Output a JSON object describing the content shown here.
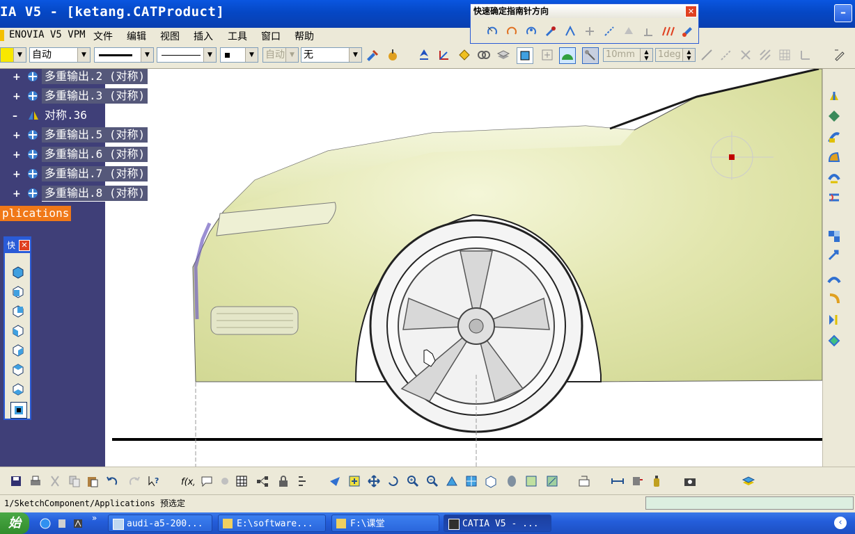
{
  "window": {
    "title": "IA V5 - [ketang.CATProduct]"
  },
  "menu": {
    "items": [
      "ENOVIA V5 VPM",
      "文件",
      "编辑",
      "视图",
      "插入",
      "工具",
      "窗口",
      "帮助"
    ]
  },
  "property_toolbar": {
    "color_combo": "自动",
    "layer_combo": "自动",
    "layer_fill_combo": "无",
    "length_field": "10mm",
    "angle_field": "1deg"
  },
  "compass_dialog": {
    "title": "快速确定指南针方向"
  },
  "tree": {
    "nodes": [
      {
        "label": "多重输出.2 (对称)"
      },
      {
        "label": "多重输出.3 (对称)"
      },
      {
        "label": "对称.36"
      },
      {
        "label": "多重输出.5 (对称)"
      },
      {
        "label": "多重输出.6 (对称)"
      },
      {
        "label": "多重输出.7 (对称)"
      },
      {
        "label": "多重输出.8 (对称)"
      }
    ],
    "applications_label": "plications"
  },
  "float_toolbar": {
    "title": "快"
  },
  "status": {
    "text": "1/SketchComponent/Applications 预选定"
  },
  "taskbar": {
    "start_label": "始",
    "tasks": [
      {
        "label": "audi-a5-200..."
      },
      {
        "label": "E:\\software..."
      },
      {
        "label": "F:\\课堂"
      },
      {
        "label": "CATIA V5 - ..."
      }
    ]
  },
  "colors": {
    "titlebar": "#0547c4",
    "tree_background": "#3f3f78",
    "car_body": "#e4e8b4",
    "highlight": "#f07818"
  }
}
